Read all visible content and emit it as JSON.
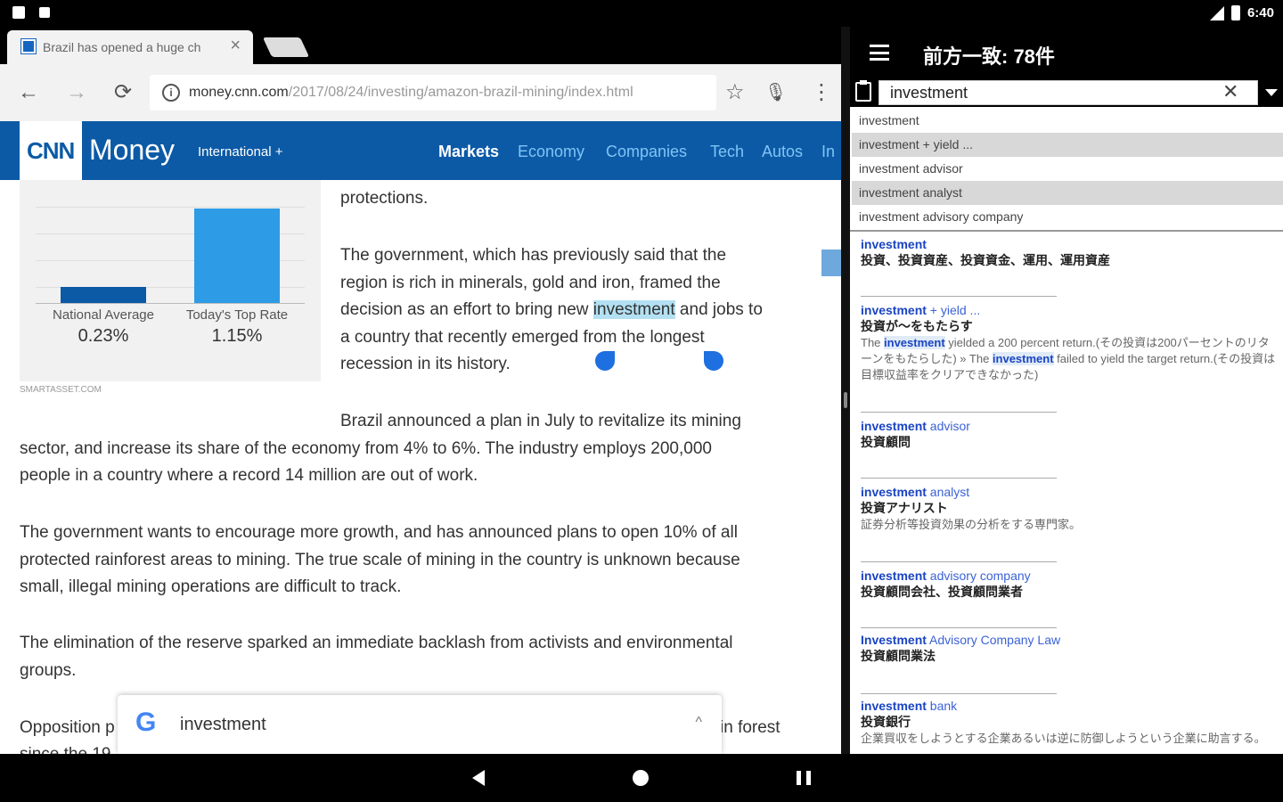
{
  "status_bar": {
    "time": "6:40"
  },
  "browser": {
    "tab_title": "Brazil has opened a huge ch",
    "tab_close": "×",
    "url_host": "money.cnn.com",
    "url_path": "/2017/08/24/investing/amazon-brazil-mining/index.html",
    "url_info": "i",
    "back": "←",
    "forward": "→",
    "reload": "⟳",
    "star": "☆",
    "mic": "🎙",
    "more": "⋮"
  },
  "cnn": {
    "logo": "CNN",
    "brand": "Money",
    "edition": "International +",
    "nav": [
      "Markets",
      "Economy",
      "Companies",
      "Tech",
      "Autos",
      "In"
    ]
  },
  "chart": {
    "bars": [
      {
        "label": "National Average",
        "value": "0.23%",
        "color": "#0c5aa6"
      },
      {
        "label": "Today's Top Rate",
        "value": "1.15%",
        "color": "#2e9be6"
      }
    ],
    "source": "SMARTASSET.COM"
  },
  "article": {
    "p0": "protections.",
    "p1_a": "The government, which has previously said that the",
    "p1_b": "region is rich in minerals, gold and iron, framed the",
    "p1_c_pre": "decision as an effort to bring new ",
    "p1_c_hl": "investment",
    "p1_c_post": " and jobs to",
    "p1_d": "a country that recently emerged from the longest",
    "p1_e": "recession in its history.",
    "p2_a": "Brazil announced a plan in July to revitalize its mining",
    "p2_b": "sector, and increase its share of the economy from 4% to 6%. The industry employs 200,000",
    "p2_c": "people in a country where a record 14 million are out of work.",
    "p3_a": "The government wants to encourage more growth, and has announced plans to open 10% of all",
    "p3_b": "protected rainforest areas to mining. The true scale of mining in the country is unknown because",
    "p3_c": "small, illegal mining operations are difficult to track.",
    "p4_a": "The elimination of the reserve sparked an immediate backlash from activists and environmental",
    "p4_b": "groups.",
    "p5_left": "Opposition p",
    "p5_right": "in forest",
    "p5_next": "since the 19"
  },
  "google_bar": {
    "logo": "G",
    "query": "investment",
    "chevron": "^"
  },
  "dict": {
    "title": "前方一致: 78件",
    "search_value": "investment",
    "clear": "✕",
    "suggestions": [
      "investment",
      "investment + yield ...",
      "investment advisor",
      "investment analyst",
      "investment advisory company"
    ],
    "entries": [
      {
        "key": "investment",
        "rest": "",
        "jp": "投資、投資資産、投資資金、運用、運用資産",
        "ex": ""
      },
      {
        "key": "investment",
        "rest": " + yield ...",
        "jp": "投資が～をもたらす",
        "ex_a": "The ",
        "ex_k1": "investment",
        "ex_b": " yielded a 200 percent return.(その投資は200パーセントのリターンをもたらした) ",
        "ex_c": "The ",
        "ex_k2": "investment",
        "ex_d": " failed to yield the target return.(その投資は目標収益率をクリアできなかった)"
      },
      {
        "key": "investment",
        "rest": " advisor",
        "jp": "投資顧問",
        "ex": ""
      },
      {
        "key": "investment",
        "rest": " analyst",
        "jp": "投資アナリスト",
        "ex": "証券分析等投資効果の分析をする専門家。"
      },
      {
        "key": "investment",
        "rest": " advisory company",
        "jp": "投資顧問会社、投資顧問業者",
        "ex": ""
      },
      {
        "key": "Investment",
        "rest": " Advisory Company Law",
        "jp": "投資顧問業法",
        "ex": ""
      },
      {
        "key": "investment",
        "rest": " bank",
        "jp": "投資銀行",
        "ex": "企業買収をしようとする企業あるいは逆に防御しようという企業に助言する。"
      }
    ]
  }
}
